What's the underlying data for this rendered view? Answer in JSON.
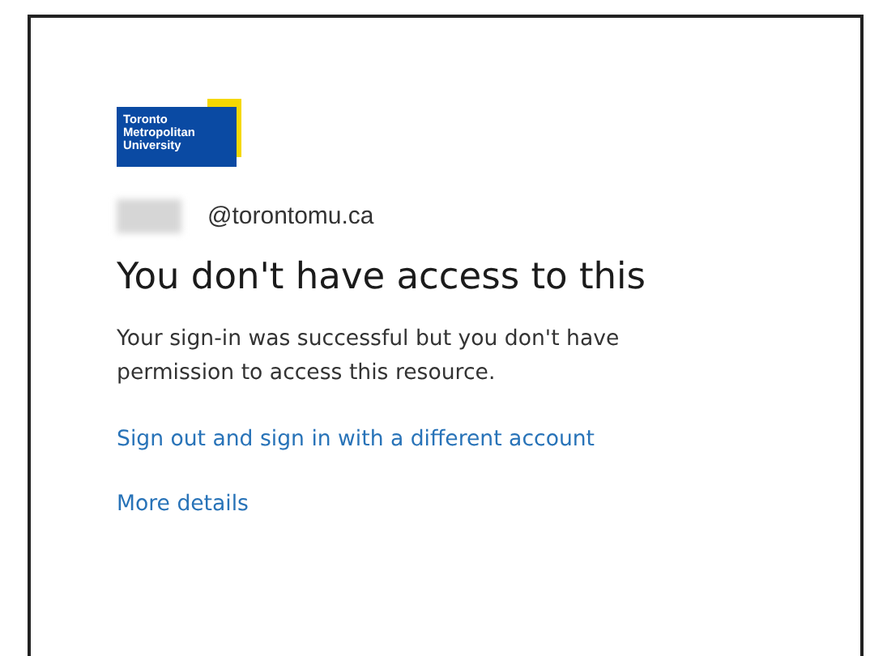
{
  "logo": {
    "lines": [
      "Toronto",
      "Metropolitan",
      "University"
    ]
  },
  "account": {
    "name_redacted": true,
    "email": "@torontomu.ca"
  },
  "heading": "You don't have access to this",
  "message": "Your sign-in was successful but you don't have permission to access this resource.",
  "links": [
    "Sign out and sign in with a different account",
    "More details"
  ]
}
